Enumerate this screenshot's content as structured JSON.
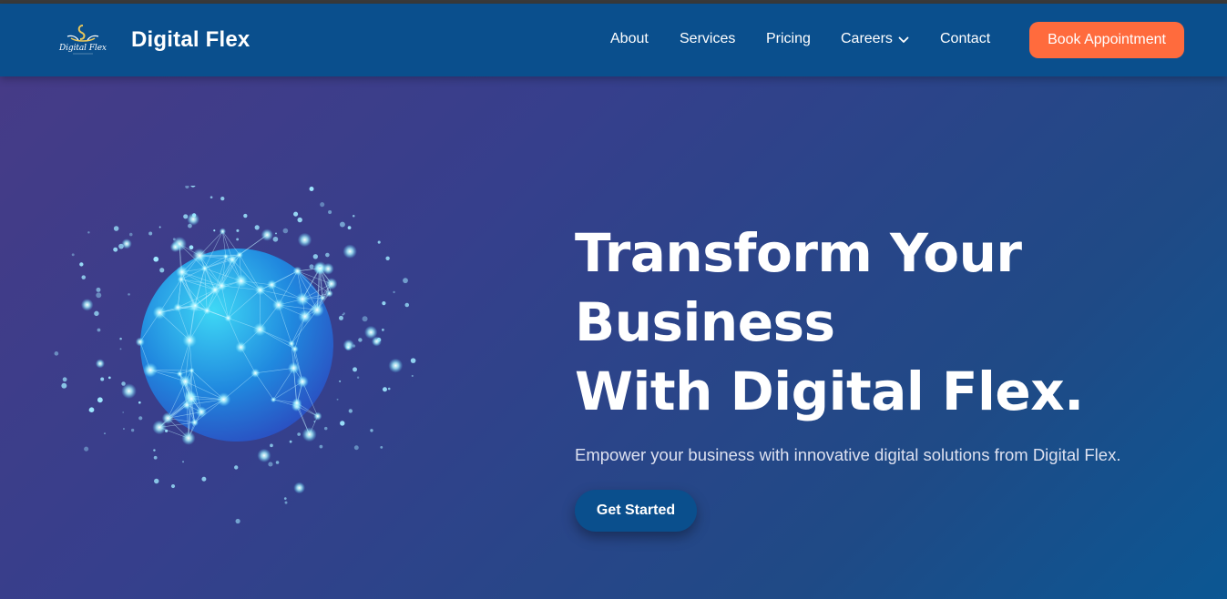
{
  "header": {
    "brand_name": "Digital Flex",
    "logo_icon": "swan-logo-icon",
    "nav_items": [
      {
        "label": "About"
      },
      {
        "label": "Services"
      },
      {
        "label": "Pricing"
      },
      {
        "label": "Careers",
        "icon": "chevron-down-icon"
      },
      {
        "label": "Contact"
      }
    ],
    "cta_label": "Book Appointment",
    "background_color": "#0a4f8d",
    "cta_color": "#ff6b3d"
  },
  "hero": {
    "headline_lines": [
      "Transform Your",
      "Business",
      "With Digital Flex."
    ],
    "subtext": "Empower your business with innovative digital solutions from Digital Flex.",
    "button_label": "Get Started",
    "button_color": "#0a4f8d",
    "illustration_icon": "network-globe-icon",
    "gradient_colors": [
      "#463b87",
      "#0b5793"
    ]
  }
}
